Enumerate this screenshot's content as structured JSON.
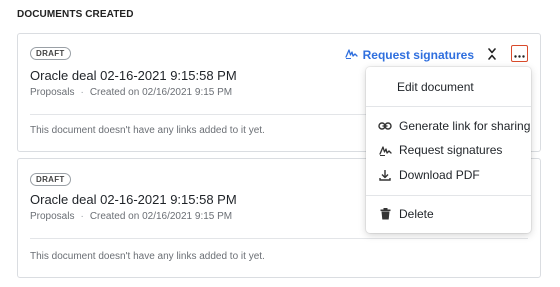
{
  "section": {
    "heading": "DOCUMENTS CREATED"
  },
  "documents": [
    {
      "status": "DRAFT",
      "title": "Oracle deal 02-16-2021 9:15:58 PM",
      "category": "Proposals",
      "created": "Created on 02/16/2021 9:15 PM",
      "links_note": "This document doesn't have any links added to it yet."
    },
    {
      "status": "DRAFT",
      "title": "Oracle deal 02-16-2021 9:15:58 PM",
      "category": "Proposals",
      "created": "Created on 02/16/2021 9:15 PM",
      "links_note": "This document doesn't have any links added to it yet."
    }
  ],
  "actions": {
    "request_signatures": "Request signatures"
  },
  "menu": {
    "items": [
      {
        "label": "Edit document",
        "icon": "none"
      },
      {
        "label": "Generate link for sharing",
        "icon": "link-icon"
      },
      {
        "label": "Request signatures",
        "icon": "signature-icon"
      },
      {
        "label": "Download PDF",
        "icon": "download-icon"
      },
      {
        "label": "Delete",
        "icon": "trash-icon"
      }
    ]
  },
  "colors": {
    "accent": "#2f6fde",
    "highlight_border": "#d94a2b"
  }
}
